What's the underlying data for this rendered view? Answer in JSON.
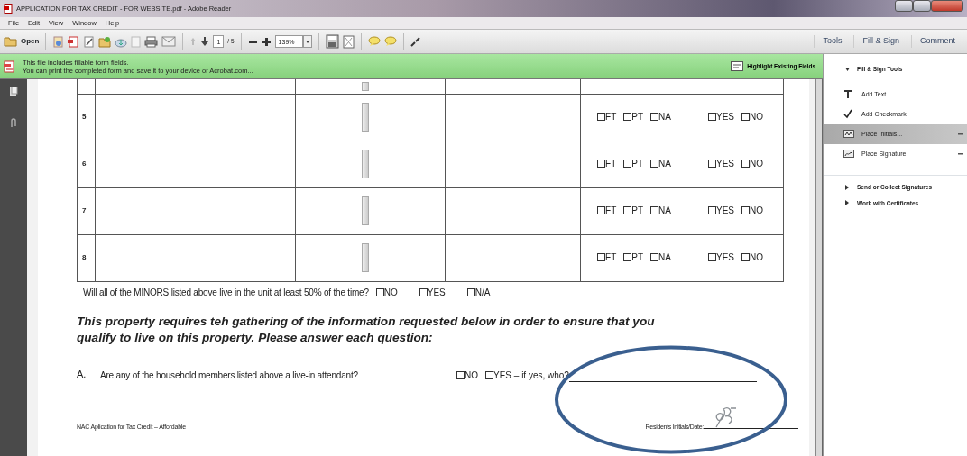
{
  "window": {
    "title": "APPLICATION FOR TAX CREDIT - FOR WEBSITE.pdf - Adobe Reader"
  },
  "menu": [
    "File",
    "Edit",
    "View",
    "Window",
    "Help"
  ],
  "toolbar": {
    "open": "Open",
    "page": "1",
    "page_total": "/ 5",
    "zoom": "139%"
  },
  "tabs": [
    "Tools",
    "Fill & Sign",
    "Comment"
  ],
  "infobar": {
    "lines": [
      "This file includes fillable form fields.",
      "You can print the completed form and save it to your device or Acrobat.com..."
    ],
    "button": "Highlight Existing Fields"
  },
  "panel": {
    "sections": [
      {
        "title": "Fill & Sign Tools",
        "expanded": true,
        "tools": [
          {
            "label": "Add Text",
            "kind": "text",
            "selected": false,
            "menu": false
          },
          {
            "label": "Add Checkmark",
            "kind": "checkmark",
            "selected": false,
            "menu": false
          },
          {
            "label": "Place Initials...",
            "kind": "initials",
            "selected": true,
            "menu": true
          },
          {
            "label": "Place Signature",
            "kind": "signature",
            "selected": false,
            "menu": true
          }
        ]
      },
      {
        "title": "Send or Collect Signatures",
        "expanded": false
      },
      {
        "title": "Work with Certificates",
        "expanded": false
      }
    ]
  },
  "form": {
    "rows": [
      {
        "number": "5",
        "status": [
          {
            "label": "FT",
            "checked": false
          },
          {
            "label": "PT",
            "checked": false
          },
          {
            "label": "NA",
            "checked": false
          }
        ],
        "answer": [
          {
            "label": "YES",
            "checked": false
          },
          {
            "label": "NO",
            "checked": false
          }
        ]
      },
      {
        "number": "6",
        "status": [
          {
            "label": "FT",
            "checked": false
          },
          {
            "label": "PT",
            "checked": false
          },
          {
            "label": "NA",
            "checked": false
          }
        ],
        "answer": [
          {
            "label": "YES",
            "checked": false
          },
          {
            "label": "NO",
            "checked": false
          }
        ]
      },
      {
        "number": "7",
        "status": [
          {
            "label": "FT",
            "checked": false
          },
          {
            "label": "PT",
            "checked": false
          },
          {
            "label": "NA",
            "checked": false
          }
        ],
        "answer": [
          {
            "label": "YES",
            "checked": false
          },
          {
            "label": "NO",
            "checked": false
          }
        ]
      },
      {
        "number": "8",
        "status": [
          {
            "label": "FT",
            "checked": false
          },
          {
            "label": "PT",
            "checked": false
          },
          {
            "label": "NA",
            "checked": false
          }
        ],
        "answer": [
          {
            "label": "YES",
            "checked": false
          },
          {
            "label": "NO",
            "checked": false
          }
        ]
      }
    ],
    "minors": {
      "question": "Will all of the MINORS listed above live in the unit at least 50% of the time?",
      "options": [
        {
          "label": "NO",
          "checked": false
        },
        {
          "label": "YES",
          "checked": false
        },
        {
          "label": "N/A",
          "checked": false
        }
      ]
    },
    "heading_lines": [
      "This property requires teh gathering of the information requested below in order to ensure that you",
      "qualify to live on this property.  Please answer each question:"
    ],
    "question_a": {
      "label": "A.",
      "text": "Are any of the household members listed above a live-in attendant?",
      "options": [
        {
          "label": "NO",
          "checked": false
        },
        {
          "label": "YES – if yes, who?",
          "checked": false
        }
      ]
    },
    "footer": "NAC Aplication for Tax Credit – Affordable",
    "initials_label": "Residents Initials/Date:"
  }
}
